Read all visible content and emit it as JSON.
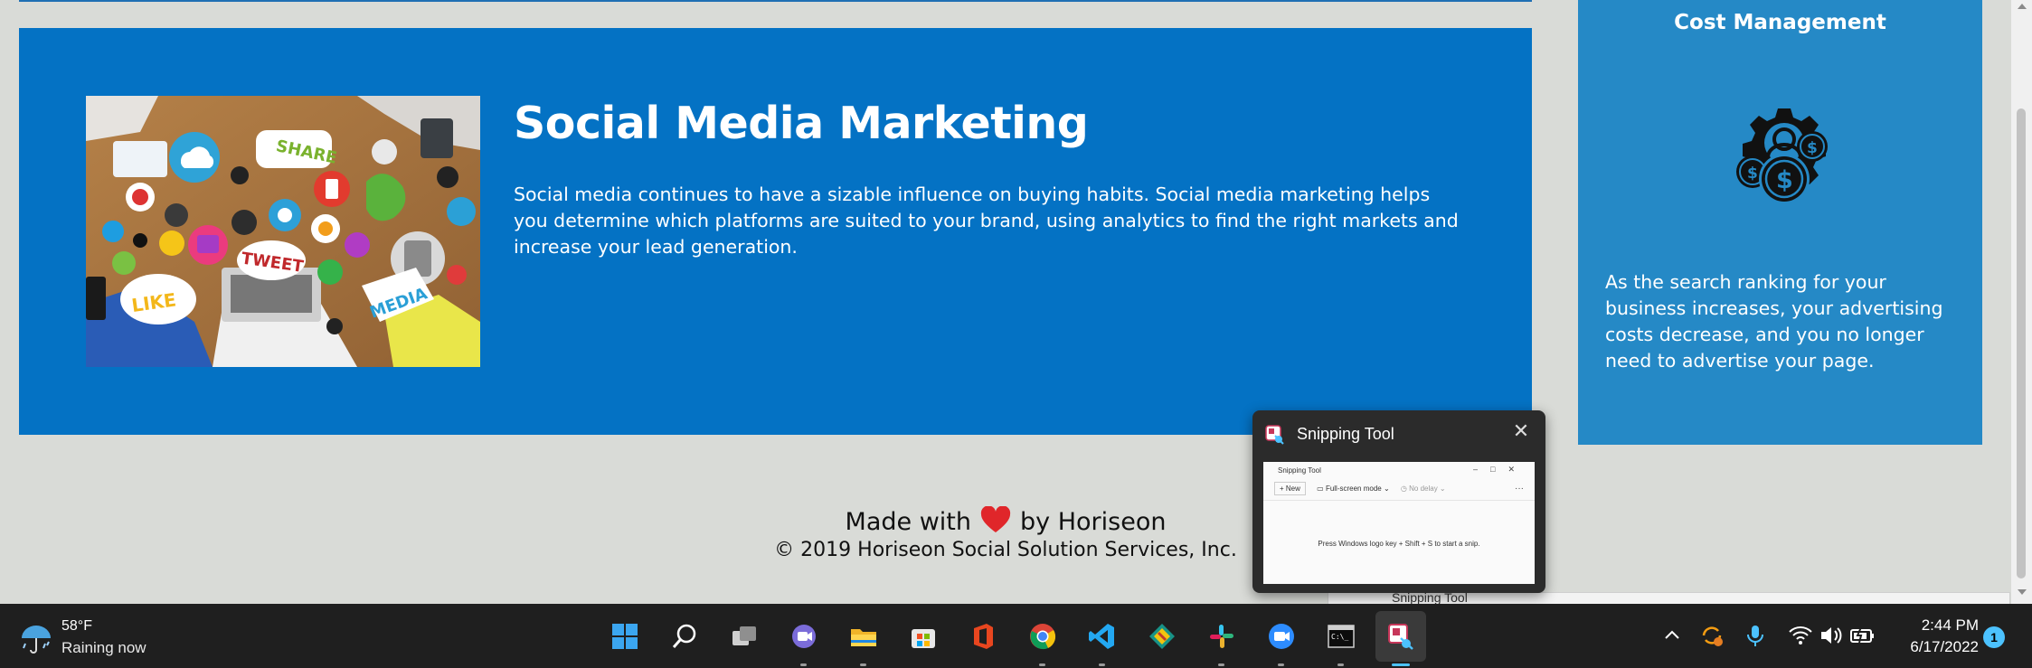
{
  "smm": {
    "title": "Social Media Marketing",
    "text": "Social media continues to have a sizable influence on buying habits. Social media marketing helps you determine which platforms are suited to your brand, using analytics to find the right markets and increase your lead generation.",
    "image_words": [
      "SHARE",
      "TWEET",
      "LIKE",
      "MEDIA"
    ]
  },
  "cost": {
    "title": "Cost Management",
    "icon": "gear-dollar-icon",
    "text": "As the search ranking for your business increases, your advertising costs decrease, and you no longer need to advertise your page."
  },
  "footer": {
    "made_with": "Made with",
    "by": "by Horiseon",
    "copyright": "© 2019 Horiseon Social Solution Services, Inc."
  },
  "snipping_popup": {
    "title": "Snipping Tool",
    "preview": {
      "title": "Snipping Tool",
      "new_label": "New",
      "mode_label": "Full-screen mode",
      "delay_label": "No delay",
      "hint": "Press Windows logo key + Shift + S to start a snip."
    }
  },
  "behind_window": {
    "title": "Snipping Tool"
  },
  "taskbar": {
    "weather": {
      "temp": "58°F",
      "desc": "Raining now",
      "icon": "rain-umbrella-icon"
    },
    "apps": [
      {
        "name": "start-icon"
      },
      {
        "name": "search-icon"
      },
      {
        "name": "task-view-icon"
      },
      {
        "name": "teams-chat-icon"
      },
      {
        "name": "file-explorer-icon"
      },
      {
        "name": "microsoft-store-icon"
      },
      {
        "name": "office-icon"
      },
      {
        "name": "chrome-icon"
      },
      {
        "name": "vscode-icon"
      },
      {
        "name": "gitkraken-icon"
      },
      {
        "name": "slack-icon"
      },
      {
        "name": "zoom-icon"
      },
      {
        "name": "terminal-icon"
      },
      {
        "name": "snipping-tool-icon"
      }
    ],
    "tray": [
      "chevron-up-icon",
      "sync-icon",
      "microphone-icon",
      "wifi-icon",
      "volume-icon",
      "battery-icon"
    ],
    "time": "2:44 PM",
    "date": "6/17/2022",
    "notification_count": "1"
  },
  "colors": {
    "smm_bg": "#0472c4",
    "cost_bg": "#2589c6",
    "page_bg": "#d9dbd7",
    "heart": "#e0262a",
    "taskbar": "#1f1f1f"
  }
}
